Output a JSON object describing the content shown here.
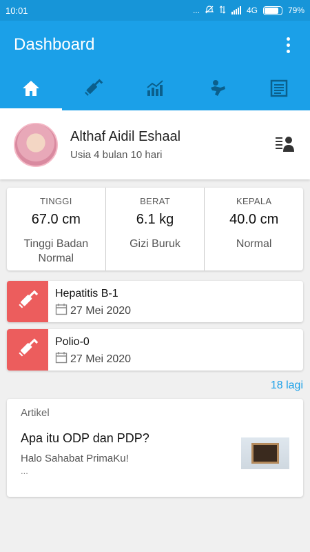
{
  "status_bar": {
    "time": "10:01",
    "dots": "...",
    "network": "4G",
    "battery": "79%"
  },
  "app_bar": {
    "title": "Dashboard"
  },
  "tabs": [
    {
      "icon": "home-icon",
      "active": true
    },
    {
      "icon": "syringe-icon",
      "active": false
    },
    {
      "icon": "growth-chart-icon",
      "active": false
    },
    {
      "icon": "child-development-icon",
      "active": false
    },
    {
      "icon": "notes-icon",
      "active": false
    }
  ],
  "profile": {
    "name": "Althaf Aidil Eshaal",
    "age": "Usia 4 bulan 10 hari"
  },
  "stats": [
    {
      "label": "TINGGI",
      "value": "67.0 cm",
      "status": "Tinggi Badan Normal"
    },
    {
      "label": "BERAT",
      "value": "6.1 kg",
      "status": "Gizi Buruk"
    },
    {
      "label": "KEPALA",
      "value": "40.0 cm",
      "status": "Normal"
    }
  ],
  "vaccines": [
    {
      "name": "Hepatitis B-1",
      "date": "27 Mei 2020"
    },
    {
      "name": "Polio-0",
      "date": "27 Mei 2020"
    }
  ],
  "more_link": "18 lagi",
  "article": {
    "section": "Artikel",
    "title": "Apa itu ODP dan PDP?",
    "excerpt": "Halo Sahabat PrimaKu!",
    "ellipsis": "..."
  },
  "colors": {
    "primary": "#1ba0e8",
    "status_bar": "#1795d8",
    "vaccine_accent": "#ec5d5d",
    "link": "#1ba0e8"
  }
}
